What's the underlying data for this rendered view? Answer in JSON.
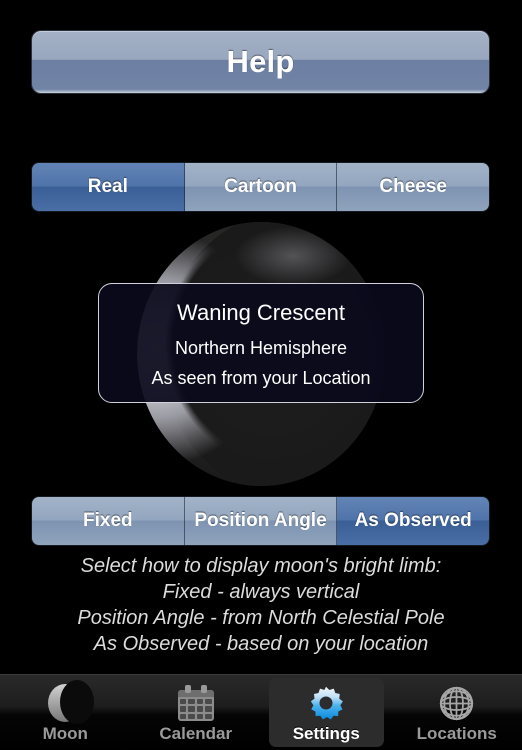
{
  "help": {
    "label": "Help"
  },
  "appearance_control": {
    "options": [
      {
        "label": "Real",
        "selected": true
      },
      {
        "label": "Cartoon",
        "selected": false
      },
      {
        "label": "Cheese",
        "selected": false
      }
    ]
  },
  "moon_info": {
    "phase": "Waning Crescent",
    "hemisphere": "Northern Hemisphere",
    "viewpoint": "As seen from your Location"
  },
  "limb_control": {
    "options": [
      {
        "label": "Fixed",
        "selected": false
      },
      {
        "label": "Position Angle",
        "selected": false
      },
      {
        "label": "As Observed",
        "selected": true
      }
    ]
  },
  "description": {
    "line1": "Select how to display moon's bright limb:",
    "line2": "Fixed - always vertical",
    "line3": "Position Angle - from North Celestial Pole",
    "line4": "As Observed - based on your location"
  },
  "tabbar": {
    "tabs": [
      {
        "label": "Moon",
        "icon": "crescent-moon-icon",
        "active": false
      },
      {
        "label": "Calendar",
        "icon": "calendar-icon",
        "active": false
      },
      {
        "label": "Settings",
        "icon": "gear-icon",
        "active": true
      },
      {
        "label": "Locations",
        "icon": "globe-icon",
        "active": false
      }
    ]
  },
  "colors": {
    "background": "#000000",
    "button_face": "#98a7be",
    "segment_selected": "#3a5f96",
    "segment_unselected": "#93a6bf",
    "accent_blue": "#1e9ae8",
    "info_box_bg": "#0a0a1c",
    "tab_active_text": "#ffffff",
    "tab_inactive_text": "#9a9a9a"
  }
}
